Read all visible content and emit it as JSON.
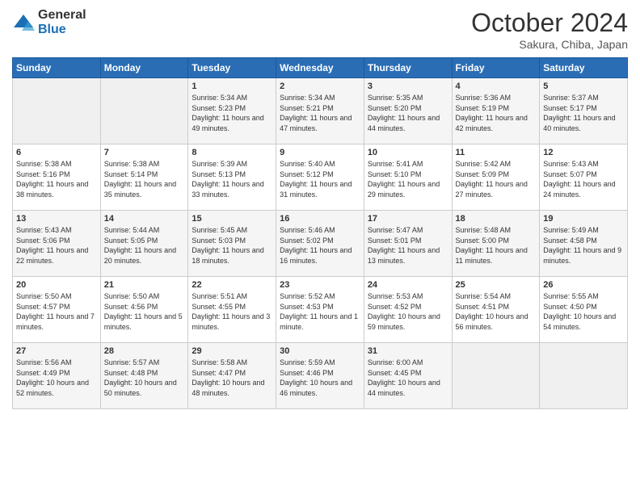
{
  "logo": {
    "general": "General",
    "blue": "Blue"
  },
  "header": {
    "month": "October 2024",
    "location": "Sakura, Chiba, Japan"
  },
  "weekdays": [
    "Sunday",
    "Monday",
    "Tuesday",
    "Wednesday",
    "Thursday",
    "Friday",
    "Saturday"
  ],
  "weeks": [
    [
      {
        "day": "",
        "info": ""
      },
      {
        "day": "",
        "info": ""
      },
      {
        "day": "1",
        "info": "Sunrise: 5:34 AM\nSunset: 5:23 PM\nDaylight: 11 hours and 49 minutes."
      },
      {
        "day": "2",
        "info": "Sunrise: 5:34 AM\nSunset: 5:21 PM\nDaylight: 11 hours and 47 minutes."
      },
      {
        "day": "3",
        "info": "Sunrise: 5:35 AM\nSunset: 5:20 PM\nDaylight: 11 hours and 44 minutes."
      },
      {
        "day": "4",
        "info": "Sunrise: 5:36 AM\nSunset: 5:19 PM\nDaylight: 11 hours and 42 minutes."
      },
      {
        "day": "5",
        "info": "Sunrise: 5:37 AM\nSunset: 5:17 PM\nDaylight: 11 hours and 40 minutes."
      }
    ],
    [
      {
        "day": "6",
        "info": "Sunrise: 5:38 AM\nSunset: 5:16 PM\nDaylight: 11 hours and 38 minutes."
      },
      {
        "day": "7",
        "info": "Sunrise: 5:38 AM\nSunset: 5:14 PM\nDaylight: 11 hours and 35 minutes."
      },
      {
        "day": "8",
        "info": "Sunrise: 5:39 AM\nSunset: 5:13 PM\nDaylight: 11 hours and 33 minutes."
      },
      {
        "day": "9",
        "info": "Sunrise: 5:40 AM\nSunset: 5:12 PM\nDaylight: 11 hours and 31 minutes."
      },
      {
        "day": "10",
        "info": "Sunrise: 5:41 AM\nSunset: 5:10 PM\nDaylight: 11 hours and 29 minutes."
      },
      {
        "day": "11",
        "info": "Sunrise: 5:42 AM\nSunset: 5:09 PM\nDaylight: 11 hours and 27 minutes."
      },
      {
        "day": "12",
        "info": "Sunrise: 5:43 AM\nSunset: 5:07 PM\nDaylight: 11 hours and 24 minutes."
      }
    ],
    [
      {
        "day": "13",
        "info": "Sunrise: 5:43 AM\nSunset: 5:06 PM\nDaylight: 11 hours and 22 minutes."
      },
      {
        "day": "14",
        "info": "Sunrise: 5:44 AM\nSunset: 5:05 PM\nDaylight: 11 hours and 20 minutes."
      },
      {
        "day": "15",
        "info": "Sunrise: 5:45 AM\nSunset: 5:03 PM\nDaylight: 11 hours and 18 minutes."
      },
      {
        "day": "16",
        "info": "Sunrise: 5:46 AM\nSunset: 5:02 PM\nDaylight: 11 hours and 16 minutes."
      },
      {
        "day": "17",
        "info": "Sunrise: 5:47 AM\nSunset: 5:01 PM\nDaylight: 11 hours and 13 minutes."
      },
      {
        "day": "18",
        "info": "Sunrise: 5:48 AM\nSunset: 5:00 PM\nDaylight: 11 hours and 11 minutes."
      },
      {
        "day": "19",
        "info": "Sunrise: 5:49 AM\nSunset: 4:58 PM\nDaylight: 11 hours and 9 minutes."
      }
    ],
    [
      {
        "day": "20",
        "info": "Sunrise: 5:50 AM\nSunset: 4:57 PM\nDaylight: 11 hours and 7 minutes."
      },
      {
        "day": "21",
        "info": "Sunrise: 5:50 AM\nSunset: 4:56 PM\nDaylight: 11 hours and 5 minutes."
      },
      {
        "day": "22",
        "info": "Sunrise: 5:51 AM\nSunset: 4:55 PM\nDaylight: 11 hours and 3 minutes."
      },
      {
        "day": "23",
        "info": "Sunrise: 5:52 AM\nSunset: 4:53 PM\nDaylight: 11 hours and 1 minute."
      },
      {
        "day": "24",
        "info": "Sunrise: 5:53 AM\nSunset: 4:52 PM\nDaylight: 10 hours and 59 minutes."
      },
      {
        "day": "25",
        "info": "Sunrise: 5:54 AM\nSunset: 4:51 PM\nDaylight: 10 hours and 56 minutes."
      },
      {
        "day": "26",
        "info": "Sunrise: 5:55 AM\nSunset: 4:50 PM\nDaylight: 10 hours and 54 minutes."
      }
    ],
    [
      {
        "day": "27",
        "info": "Sunrise: 5:56 AM\nSunset: 4:49 PM\nDaylight: 10 hours and 52 minutes."
      },
      {
        "day": "28",
        "info": "Sunrise: 5:57 AM\nSunset: 4:48 PM\nDaylight: 10 hours and 50 minutes."
      },
      {
        "day": "29",
        "info": "Sunrise: 5:58 AM\nSunset: 4:47 PM\nDaylight: 10 hours and 48 minutes."
      },
      {
        "day": "30",
        "info": "Sunrise: 5:59 AM\nSunset: 4:46 PM\nDaylight: 10 hours and 46 minutes."
      },
      {
        "day": "31",
        "info": "Sunrise: 6:00 AM\nSunset: 4:45 PM\nDaylight: 10 hours and 44 minutes."
      },
      {
        "day": "",
        "info": ""
      },
      {
        "day": "",
        "info": ""
      }
    ]
  ]
}
